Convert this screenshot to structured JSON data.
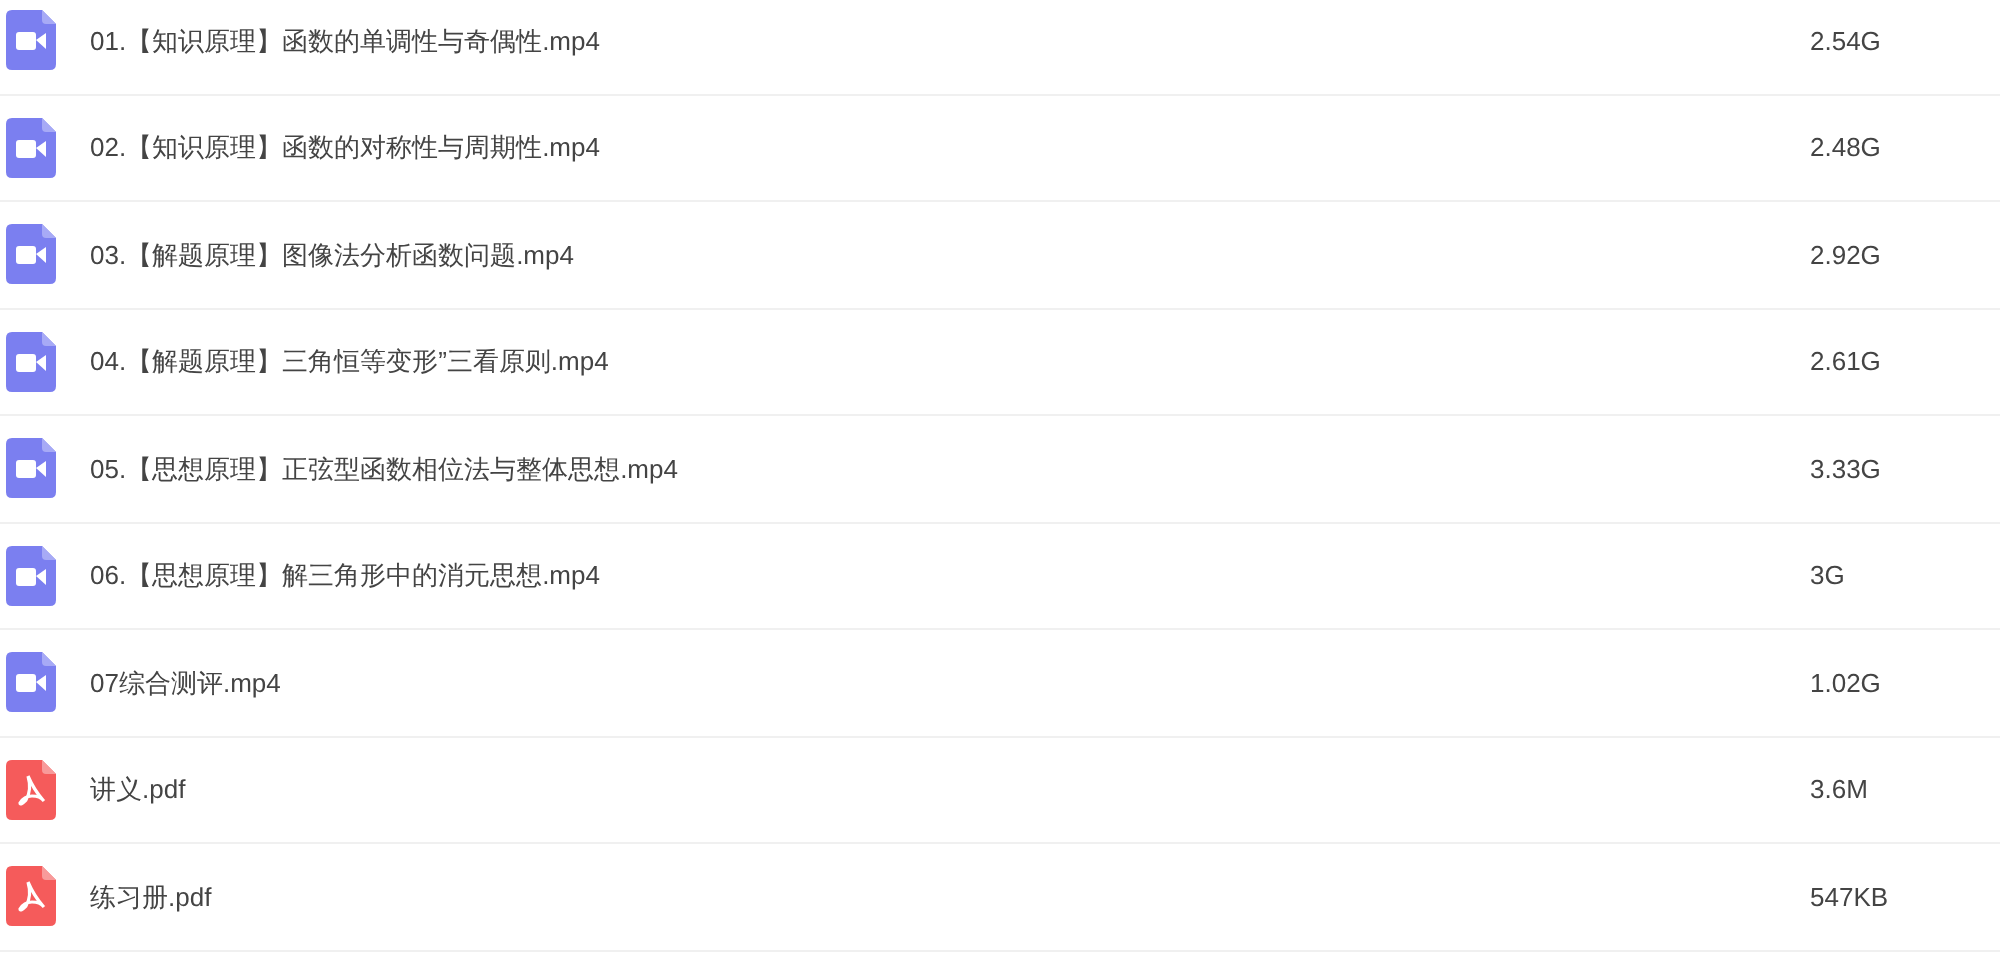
{
  "files": [
    {
      "kind": "video",
      "name": "01.【知识原理】函数的单调性与奇偶性.mp4",
      "size": "2.54G"
    },
    {
      "kind": "video",
      "name": "02.【知识原理】函数的对称性与周期性.mp4",
      "size": "2.48G"
    },
    {
      "kind": "video",
      "name": "03.【解题原理】图像法分析函数问题.mp4",
      "size": "2.92G"
    },
    {
      "kind": "video",
      "name": "04.【解题原理】三角恒等变形”三看原则.mp4",
      "size": "2.61G"
    },
    {
      "kind": "video",
      "name": "05.【思想原理】正弦型函数相位法与整体思想.mp4",
      "size": "3.33G"
    },
    {
      "kind": "video",
      "name": "06.【思想原理】解三角形中的消元思想.mp4",
      "size": "3G"
    },
    {
      "kind": "video",
      "name": "07综合测评.mp4",
      "size": "1.02G"
    },
    {
      "kind": "pdf",
      "name": "讲义.pdf",
      "size": "3.6M"
    },
    {
      "kind": "pdf",
      "name": "练习册.pdf",
      "size": "547KB"
    }
  ]
}
